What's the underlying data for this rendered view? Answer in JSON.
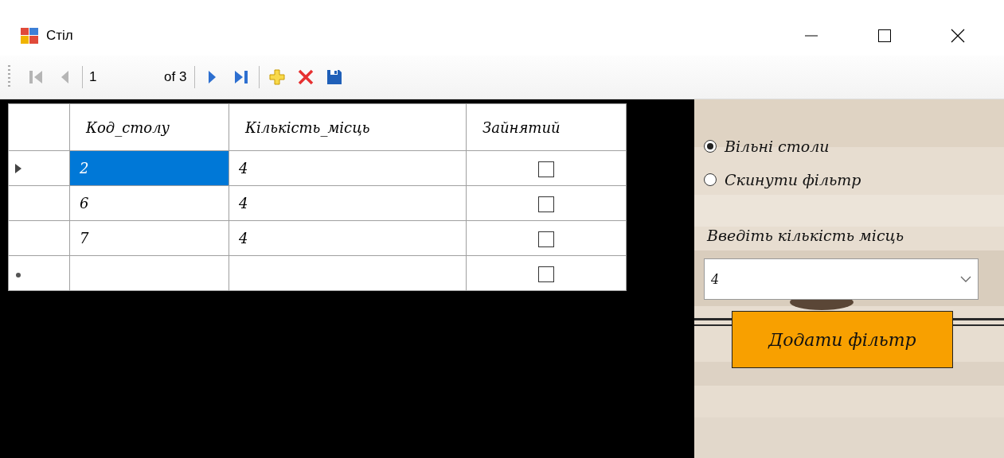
{
  "window": {
    "title": "Стіл"
  },
  "navigator": {
    "items": [
      {
        "kind": "first",
        "disabled": true
      },
      {
        "kind": "prev",
        "disabled": true
      },
      {
        "kind": "position",
        "value": "1"
      },
      {
        "kind": "count",
        "text": "of 3"
      },
      {
        "kind": "next",
        "disabled": false
      },
      {
        "kind": "last",
        "disabled": false
      },
      {
        "kind": "add"
      },
      {
        "kind": "delete"
      },
      {
        "kind": "save"
      }
    ]
  },
  "table": {
    "columns": [
      "Код_столу",
      "Кількість_місць",
      "Зайнятий"
    ],
    "rows": [
      {
        "kind": "data",
        "current": true,
        "cells": [
          {
            "text": "2",
            "selected": true
          },
          {
            "text": "4",
            "selected": false
          }
        ],
        "occupied": false
      },
      {
        "kind": "data",
        "current": false,
        "cells": [
          {
            "text": "6",
            "selected": false
          },
          {
            "text": "4",
            "selected": false
          }
        ],
        "occupied": false
      },
      {
        "kind": "data",
        "current": false,
        "cells": [
          {
            "text": "7",
            "selected": false
          },
          {
            "text": "4",
            "selected": false
          }
        ],
        "occupied": false
      },
      {
        "kind": "new",
        "current": false,
        "cells": [],
        "occupied": false
      }
    ]
  },
  "filter": {
    "options": [
      {
        "label": "Вільні столи",
        "selected": true
      },
      {
        "label": "Скинути фільтр",
        "selected": false
      }
    ],
    "seats_label": "Введіть кількість місць",
    "seats_value": "4",
    "apply_button": "Додати фільтр"
  }
}
